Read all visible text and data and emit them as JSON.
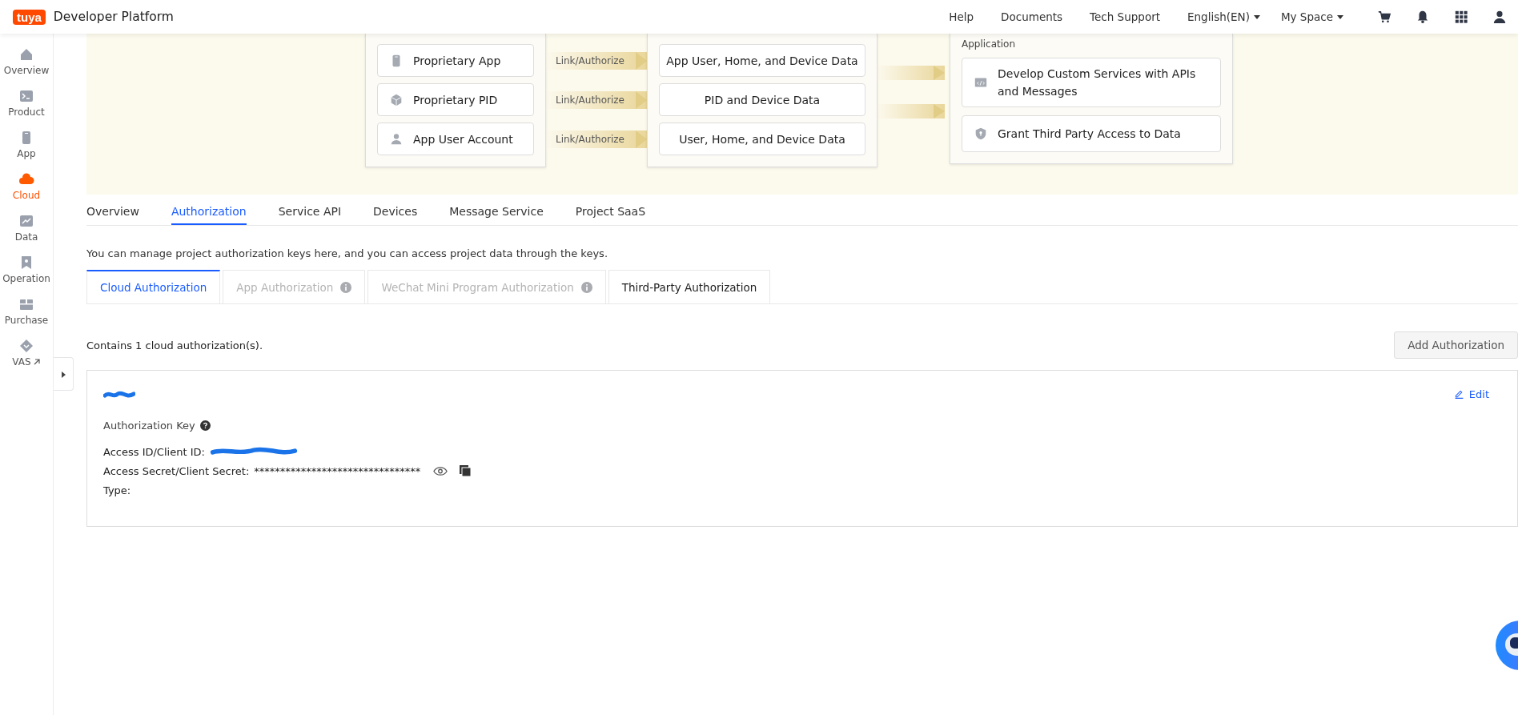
{
  "header": {
    "brand": "tuya",
    "title": "Developer Platform",
    "links": [
      "Help",
      "Documents",
      "Tech Support"
    ],
    "language": "English(EN)",
    "space": "My Space"
  },
  "sidebar": {
    "items": [
      {
        "label": "Overview",
        "selected": false,
        "external": false
      },
      {
        "label": "Product",
        "selected": false,
        "external": false
      },
      {
        "label": "App",
        "selected": false,
        "external": false
      },
      {
        "label": "Cloud",
        "selected": true,
        "external": false
      },
      {
        "label": "Data",
        "selected": false,
        "external": false
      },
      {
        "label": "Operation",
        "selected": false,
        "external": false
      },
      {
        "label": "Purchase",
        "selected": false,
        "external": false
      },
      {
        "label": "VAS",
        "selected": false,
        "external": true
      }
    ]
  },
  "diagram": {
    "sources": [
      {
        "label": "Proprietary App",
        "link": "Link/Authorize",
        "target": "App User, Home, and Device Data"
      },
      {
        "label": "Proprietary PID",
        "link": "Link/Authorize",
        "target": "PID and Device Data"
      },
      {
        "label": "App User Account",
        "link": "Link/Authorize",
        "target": "User, Home, and Device Data"
      }
    ],
    "application": {
      "title": "Application",
      "items": [
        {
          "label": "Develop Custom Services with APIs and Messages"
        },
        {
          "label": "Grant Third Party Access to Data"
        }
      ]
    }
  },
  "tabs": [
    {
      "label": "Overview",
      "selected": false
    },
    {
      "label": "Authorization",
      "selected": true
    },
    {
      "label": "Service API",
      "selected": false
    },
    {
      "label": "Devices",
      "selected": false
    },
    {
      "label": "Message Service",
      "selected": false
    },
    {
      "label": "Project SaaS",
      "selected": false
    }
  ],
  "description": "You can manage project authorization keys here, and you can access project data through the keys.",
  "subtabs": [
    {
      "label": "Cloud Authorization",
      "selected": true,
      "disabled": false,
      "info": false
    },
    {
      "label": "App Authorization",
      "selected": false,
      "disabled": true,
      "info": true
    },
    {
      "label": "WeChat Mini Program Authorization",
      "selected": false,
      "disabled": true,
      "info": true
    },
    {
      "label": "Third-Party Authorization",
      "selected": false,
      "disabled": false,
      "info": false
    }
  ],
  "count_text": "Contains 1 cloud authorization(s).",
  "add_button": "Add Authorization",
  "card": {
    "edit": "Edit",
    "key_title": "Authorization Key",
    "fields": [
      {
        "label": "Access ID/Client ID:",
        "kind": "redacted"
      },
      {
        "label": "Access Secret/Client Secret:",
        "value": "********************************",
        "kind": "secret"
      },
      {
        "label": "Type:",
        "kind": "plain"
      }
    ]
  }
}
